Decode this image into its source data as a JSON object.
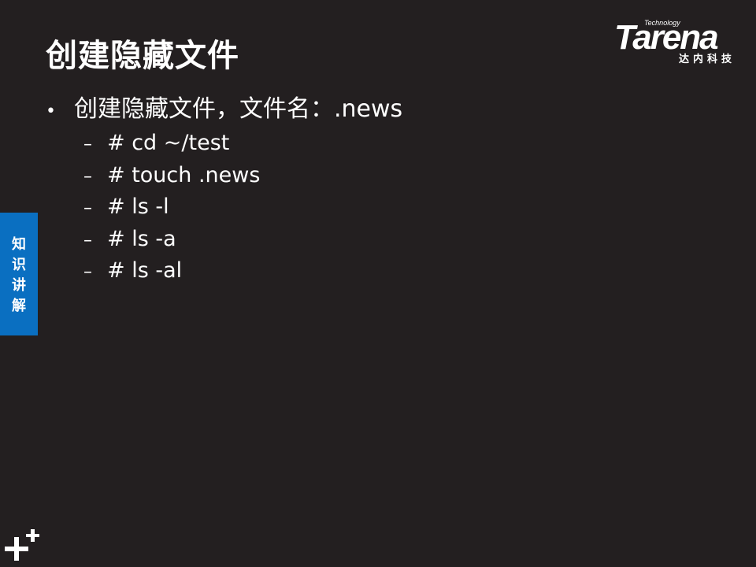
{
  "slide": {
    "title": "创建隐藏文件",
    "bullet": "创建隐藏文件，文件名：.news",
    "sub_items": [
      "# cd ~/test",
      "# touch .news",
      "# ls -l",
      "# ls -a",
      "# ls -al"
    ]
  },
  "logo": {
    "small_text": "Technology",
    "brand": "Tarena",
    "chinese": "达内科技"
  },
  "side_tab": {
    "label": "知识讲解"
  },
  "icons": {
    "bottom_left": "plus-icon"
  },
  "colors": {
    "background": "#231f20",
    "text": "#ffffff",
    "tab": "#0a6fc1"
  }
}
